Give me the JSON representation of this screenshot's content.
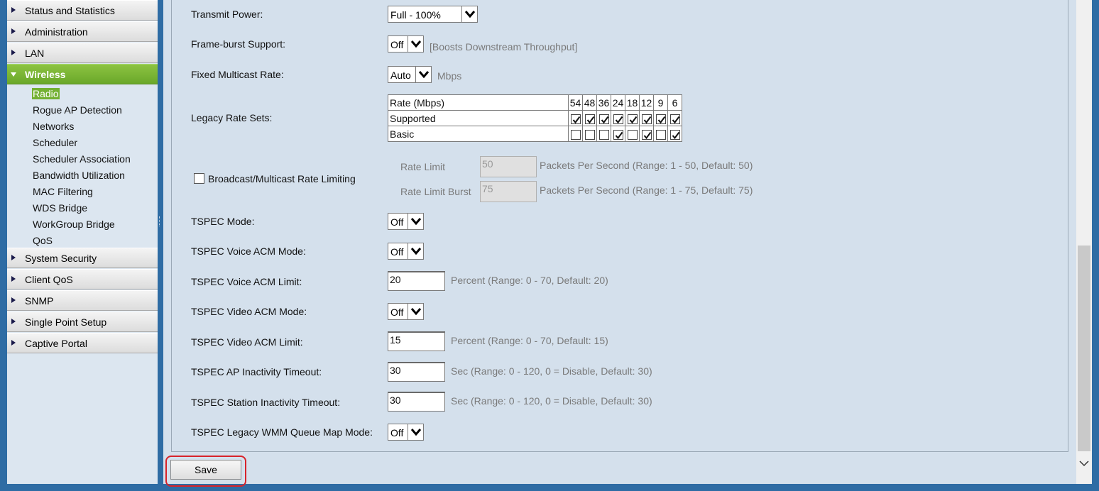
{
  "sidebar": {
    "items_top": [
      {
        "label": "Status and Statistics"
      },
      {
        "label": "Administration"
      },
      {
        "label": "LAN"
      }
    ],
    "active": {
      "label": "Wireless"
    },
    "sub_items": [
      {
        "label": "Radio",
        "selected": true
      },
      {
        "label": "Rogue AP Detection"
      },
      {
        "label": "Networks"
      },
      {
        "label": "Scheduler"
      },
      {
        "label": "Scheduler Association"
      },
      {
        "label": "Bandwidth Utilization"
      },
      {
        "label": "MAC Filtering"
      },
      {
        "label": "WDS Bridge"
      },
      {
        "label": "WorkGroup Bridge"
      },
      {
        "label": "QoS"
      }
    ],
    "items_bottom": [
      {
        "label": "System Security"
      },
      {
        "label": "Client QoS"
      },
      {
        "label": "SNMP"
      },
      {
        "label": "Single Point Setup"
      },
      {
        "label": "Captive Portal"
      }
    ]
  },
  "form": {
    "transmit_power": {
      "label": "Transmit Power:",
      "value": "Full - 100%"
    },
    "frame_burst": {
      "label": "Frame-burst Support:",
      "value": "Off",
      "hint": "[Boosts Downstream Throughput]"
    },
    "fixed_multicast": {
      "label": "Fixed Multicast Rate:",
      "value": "Auto",
      "hint": "Mbps"
    },
    "legacy_rate_sets": {
      "label": "Legacy Rate Sets:",
      "header": "Rate (Mbps)",
      "rates": [
        "54",
        "48",
        "36",
        "24",
        "18",
        "12",
        "9",
        "6"
      ],
      "rows": [
        {
          "name": "Supported",
          "checked": [
            true,
            true,
            true,
            true,
            true,
            true,
            true,
            true
          ]
        },
        {
          "name": "Basic",
          "checked": [
            false,
            false,
            false,
            true,
            false,
            true,
            false,
            true
          ]
        }
      ]
    },
    "broadcast_limit": {
      "label": "Broadcast/Multicast Rate Limiting",
      "checked": false,
      "rate_limit_label": "Rate Limit",
      "rate_limit_value": "50",
      "rate_limit_hint": "Packets Per Second (Range: 1 - 50, Default: 50)",
      "burst_label": "Rate Limit Burst",
      "burst_value": "75",
      "burst_hint": "Packets Per Second (Range: 1 - 75, Default: 75)"
    },
    "tspec_mode": {
      "label": "TSPEC Mode:",
      "value": "Off"
    },
    "tspec_voice_acm_mode": {
      "label": "TSPEC Voice ACM Mode:",
      "value": "Off"
    },
    "tspec_voice_acm_limit": {
      "label": "TSPEC Voice ACM Limit:",
      "value": "20",
      "hint": "Percent (Range: 0 - 70, Default: 20)"
    },
    "tspec_video_acm_mode": {
      "label": "TSPEC Video ACM Mode:",
      "value": "Off"
    },
    "tspec_video_acm_limit": {
      "label": "TSPEC Video ACM Limit:",
      "value": "15",
      "hint": "Percent (Range: 0 - 70, Default: 15)"
    },
    "tspec_ap_timeout": {
      "label": "TSPEC AP Inactivity Timeout:",
      "value": "30",
      "hint": "Sec (Range: 0 - 120, 0 = Disable, Default: 30)"
    },
    "tspec_station_timeout": {
      "label": "TSPEC Station Inactivity Timeout:",
      "value": "30",
      "hint": "Sec (Range: 0 - 120, 0 = Disable, Default: 30)"
    },
    "tspec_legacy_wmm": {
      "label": "TSPEC Legacy WMM Queue Map Mode:",
      "value": "Off"
    }
  },
  "save_label": "Save",
  "colors": {
    "accent_green": "#74b133",
    "highlight_red": "#d8232a",
    "frame_blue": "#2e6ca4"
  }
}
